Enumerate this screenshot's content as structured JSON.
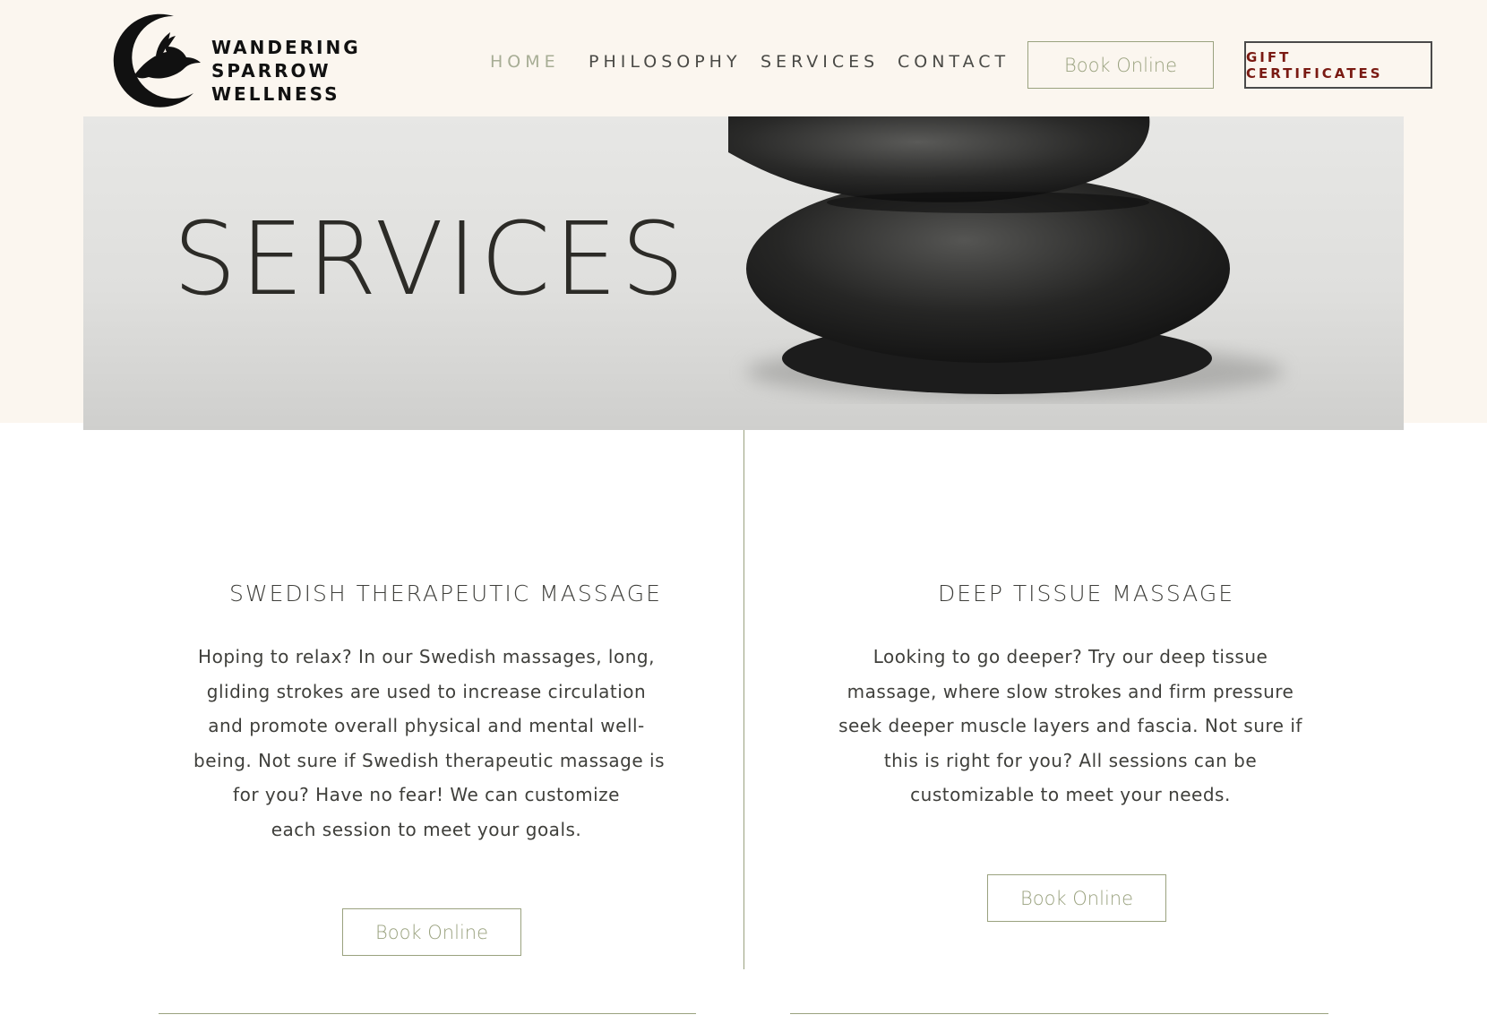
{
  "brand": {
    "line1": "WANDERING",
    "line2": "SPARROW",
    "line3": "WELLNESS"
  },
  "nav": {
    "items": [
      {
        "label": "HOME",
        "active": true
      },
      {
        "label": "PHILOSOPHY",
        "active": false
      },
      {
        "label": "SERVICES",
        "active": false
      },
      {
        "label": "CONTACT",
        "active": false
      }
    ],
    "book_label": "Book Online",
    "gift_label": "GIFT CERTIFICATES"
  },
  "hero": {
    "title": "SERVICES"
  },
  "services": [
    {
      "title": "SWEDISH THERAPEUTIC MASSAGE",
      "lines": [
        "Hoping to relax? In our Swedish massages, long,",
        "gliding strokes are used to increase circulation",
        "and promote overall physical and mental well-",
        "being. Not sure if Swedish therapeutic massage is",
        "for you? Have no fear! We can customize",
        "each session to meet your goals."
      ],
      "button_label": "Book Online"
    },
    {
      "title": "DEEP TISSUE MASSAGE",
      "lines": [
        "Looking to go deeper? Try our deep tissue",
        "massage, where slow strokes and firm pressure",
        "seek deeper muscle layers and fascia. Not sure if",
        "this is right for you? All sessions can be",
        "customizable to meet your needs."
      ],
      "button_label": "Book Online"
    }
  ],
  "colors": {
    "accent": "#9aa27f",
    "nav_active": "#a7ad95",
    "gift_text": "#7a1a12",
    "header_bg": "#fbf6ef"
  }
}
